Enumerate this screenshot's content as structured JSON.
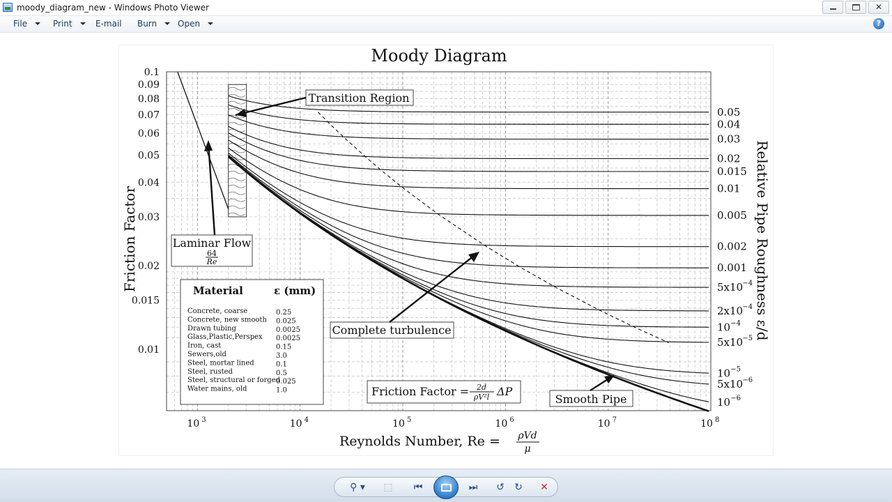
{
  "window": {
    "title": "moody_diagram_new - Windows Photo Viewer",
    "close_glyph": "✕"
  },
  "menu": {
    "file": "File",
    "print": "Print",
    "email": "E-mail",
    "burn": "Burn",
    "open": "Open"
  },
  "help_glyph": "?",
  "toolbar": {
    "zoom_glyph": "⚲ ▾",
    "fit_glyph": "⬚",
    "prev_glyph": "⏮",
    "next_glyph": "⏭",
    "rotate_ccw_glyph": "↺",
    "rotate_cw_glyph": "↻",
    "delete_glyph": "✕"
  },
  "icons": [
    "app-icon",
    "minimize-icon",
    "maximize-icon",
    "close-icon",
    "help-icon",
    "zoom-icon",
    "fit-window-icon",
    "previous-icon",
    "slideshow-icon",
    "next-icon",
    "rotate-counterclockwise-icon",
    "rotate-clockwise-icon",
    "delete-icon"
  ],
  "chart_data": {
    "type": "line",
    "title": "Moody Diagram",
    "xlabel": "Reynolds Number, Re = ρVd/μ",
    "ylabel": "Friction Factor",
    "y2label": "Relative Pipe Roughness ε/d",
    "x_scale": "log",
    "y_scale": "log",
    "xlim": [
      500,
      100000000
    ],
    "ylim": [
      0.006,
      0.1
    ],
    "grid": true,
    "x_ticks": [
      {
        "value": 1000,
        "base": "10",
        "exp": "3"
      },
      {
        "value": 10000,
        "base": "10",
        "exp": "4"
      },
      {
        "value": 100000,
        "base": "10",
        "exp": "5"
      },
      {
        "value": 1000000,
        "base": "10",
        "exp": "6"
      },
      {
        "value": 10000000,
        "base": "10",
        "exp": "7"
      },
      {
        "value": 100000000,
        "base": "10",
        "exp": "8"
      }
    ],
    "y_ticks": [
      {
        "value": 0.1,
        "label": "0.1"
      },
      {
        "value": 0.09,
        "label": "0.09"
      },
      {
        "value": 0.08,
        "label": "0.08"
      },
      {
        "value": 0.07,
        "label": "0.07"
      },
      {
        "value": 0.06,
        "label": "0.06"
      },
      {
        "value": 0.05,
        "label": "0.05"
      },
      {
        "value": 0.04,
        "label": "0.04"
      },
      {
        "value": 0.03,
        "label": "0.03"
      },
      {
        "value": 0.02,
        "label": "0.02"
      },
      {
        "value": 0.015,
        "label": "0.015"
      },
      {
        "value": 0.01,
        "label": "0.01"
      }
    ],
    "roughness_labels": [
      {
        "value": 0.05,
        "base": "0.05",
        "exp": ""
      },
      {
        "value": 0.04,
        "base": "0.04",
        "exp": ""
      },
      {
        "value": 0.03,
        "base": "0.03",
        "exp": ""
      },
      {
        "value": 0.02,
        "base": "0.02",
        "exp": ""
      },
      {
        "value": 0.015,
        "base": "0.015",
        "exp": ""
      },
      {
        "value": 0.01,
        "base": "0.01",
        "exp": ""
      },
      {
        "value": 0.005,
        "base": "0.005",
        "exp": ""
      },
      {
        "value": 0.002,
        "base": "0.002",
        "exp": ""
      },
      {
        "value": 0.001,
        "base": "0.001",
        "exp": ""
      },
      {
        "value": 0.0005,
        "base": "5x10",
        "exp": "−4"
      },
      {
        "value": 0.0002,
        "base": "2x10",
        "exp": "−4"
      },
      {
        "value": 0.0001,
        "base": "10",
        "exp": "−4"
      },
      {
        "value": 5e-05,
        "base": "5x10",
        "exp": "−5"
      },
      {
        "value": 1e-05,
        "base": "10",
        "exp": "−5"
      },
      {
        "value": 5e-06,
        "base": "5x10",
        "exp": "−6"
      },
      {
        "value": 1e-06,
        "base": "10",
        "exp": "−6"
      }
    ],
    "transition_region": {
      "re_min": 2000,
      "re_max": 3000,
      "f_min": 0.03,
      "f_max": 0.09
    },
    "annotations": {
      "transition": "Transition Region",
      "laminar_title": "Laminar Flow",
      "laminar_num": "64",
      "laminar_den": "Re",
      "complete_turbulence": "Complete turbulence",
      "smooth_pipe": "Smooth Pipe",
      "formula_lhs": "Friction Factor =",
      "formula_num": "2d",
      "formula_den": "ρV²l",
      "formula_tail": "ΔP",
      "re_lhs": "Reynolds Number, Re =",
      "re_num": "ρVd",
      "re_den": "μ"
    },
    "materials": {
      "header_name": "Material",
      "header_value": "ε (mm)",
      "rows": [
        {
          "name": "Concrete, coarse",
          "value": "0.25"
        },
        {
          "name": "Concrete, new smooth",
          "value": "0.025"
        },
        {
          "name": "Drawn tubing",
          "value": "0.0025"
        },
        {
          "name": "Glass,Plastic,Perspex",
          "value": "0.0025"
        },
        {
          "name": "Iron, cast",
          "value": "0.15"
        },
        {
          "name": "Sewers,old",
          "value": "3.0"
        },
        {
          "name": "Steel, mortar lined",
          "value": "0.1"
        },
        {
          "name": "Steel, rusted",
          "value": "0.5"
        },
        {
          "name": "Steel, structural or forged",
          "value": "0.025"
        },
        {
          "name": "Water mains, old",
          "value": "1.0"
        }
      ]
    }
  }
}
